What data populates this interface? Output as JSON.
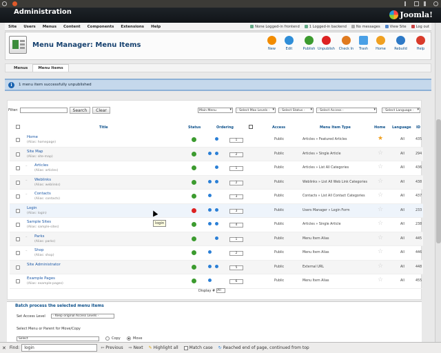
{
  "app": {
    "title": "Administration",
    "logo_text": "Joomla!"
  },
  "menubar": {
    "items": [
      "Site",
      "Users",
      "Menus",
      "Content",
      "Components",
      "Extensions",
      "Help"
    ],
    "status": [
      "None Logged-in frontend",
      "1 Logged-in backend",
      "No messages",
      "View Site",
      "Log out"
    ]
  },
  "page": {
    "title": "Menu Manager: Menu Items"
  },
  "toolbar": {
    "buttons": [
      {
        "label": "New",
        "color": "#f28c00"
      },
      {
        "label": "Edit",
        "color": "#2f8ed8"
      },
      {
        "label": "Publish",
        "color": "#3c9b2f"
      },
      {
        "label": "Unpublish",
        "color": "#d22"
      },
      {
        "label": "Check In",
        "color": "#e07a1f"
      },
      {
        "label": "Trash",
        "color": "#4aa0e6"
      },
      {
        "label": "Home",
        "color": "#f0a020"
      },
      {
        "label": "Rebuild",
        "color": "#2d79c7"
      },
      {
        "label": "Help",
        "color": "#d93b2b"
      }
    ]
  },
  "subnav": {
    "tabs": [
      "Menus",
      "Menu Items"
    ]
  },
  "message": {
    "text": "1 menu item successfully unpublished"
  },
  "filters": {
    "label": "Filter:",
    "search_value": "",
    "search_button": "Search",
    "clear_button": "Clear",
    "selects": [
      "Main Menu",
      "- Select Max Levels -",
      "- Select Status -",
      "- Select Access -",
      "- Select Language -"
    ]
  },
  "table": {
    "headers": {
      "title": "Title",
      "status": "Status",
      "ordering": "Ordering",
      "access": "Access",
      "type": "Menu Item Type",
      "home": "Home",
      "language": "Language",
      "id": "ID"
    },
    "rows": [
      {
        "title": "Home",
        "alias": "(Alias: homepage)",
        "level": 1,
        "status": "published",
        "ord": "1",
        "up": false,
        "down": true,
        "access": "Public",
        "type": "Articles » Featured Articles",
        "home": true,
        "lang": "All",
        "id": "435"
      },
      {
        "title": "Site Map",
        "alias": "(Alias: site-map)",
        "level": 1,
        "status": "published",
        "ord": "2",
        "up": true,
        "down": true,
        "access": "Public",
        "type": "Articles » Single Article",
        "home": false,
        "lang": "All",
        "id": "294"
      },
      {
        "title": "Articles",
        "alias": "(Alias: articles)",
        "level": 2,
        "status": "published",
        "ord": "1",
        "up": false,
        "down": true,
        "access": "Public",
        "type": "Articles » List All Categories",
        "home": false,
        "lang": "All",
        "id": "436"
      },
      {
        "title": "Weblinks",
        "alias": "(Alias: weblinks)",
        "level": 2,
        "status": "published",
        "ord": "2",
        "up": true,
        "down": true,
        "access": "Public",
        "type": "Weblinks » List All Web Link Categories",
        "home": false,
        "lang": "All",
        "id": "438"
      },
      {
        "title": "Contacts",
        "alias": "(Alias: contacts)",
        "level": 2,
        "status": "published",
        "ord": "3",
        "up": true,
        "down": false,
        "access": "Public",
        "type": "Contacts » List All Contact Categories",
        "home": false,
        "lang": "All",
        "id": "437"
      },
      {
        "title": "Login",
        "alias": "(Alias: login)",
        "level": 1,
        "status": "unpublished",
        "ord": "3",
        "up": true,
        "down": true,
        "access": "Public",
        "type": "Users Manager » Login Form",
        "home": false,
        "lang": "All",
        "id": "233"
      },
      {
        "title": "Sample Sites",
        "alias": "(Alias: sample-sites)",
        "level": 1,
        "status": "published",
        "ord": "4",
        "up": true,
        "down": true,
        "access": "Public",
        "type": "Articles » Single Article",
        "home": false,
        "lang": "All",
        "id": "238"
      },
      {
        "title": "Parks",
        "alias": "(Alias: parks)",
        "level": 2,
        "status": "published",
        "ord": "1",
        "up": false,
        "down": true,
        "access": "Public",
        "type": "Menu Item Alias",
        "home": false,
        "lang": "All",
        "id": "445"
      },
      {
        "title": "Shop",
        "alias": "(Alias: shop)",
        "level": 2,
        "status": "published",
        "ord": "2",
        "up": true,
        "down": false,
        "access": "Public",
        "type": "Menu Item Alias",
        "home": false,
        "lang": "All",
        "id": "446"
      },
      {
        "title": "Site Administrator",
        "alias": "",
        "level": 1,
        "status": "published",
        "ord": "5",
        "up": true,
        "down": true,
        "access": "Public",
        "type": "External URL",
        "home": false,
        "lang": "All",
        "id": "448"
      },
      {
        "title": "Example Pages",
        "alias": "(Alias: example-pages)",
        "level": 1,
        "status": "published",
        "ord": "6",
        "up": true,
        "down": false,
        "access": "Public",
        "type": "Menu Item Alias",
        "home": false,
        "lang": "All",
        "id": "455"
      }
    ]
  },
  "display": {
    "label": "Display #",
    "value": "All"
  },
  "batch": {
    "title": "Batch process the selected menu items",
    "access_label": "Set Access Level",
    "access_value": "- Keep original Access Levels -",
    "move_label": "Select Menu or Parent for Move/Copy",
    "select_value": "Select",
    "copy_label": "Copy",
    "move_option": "Move"
  },
  "tooltip": {
    "text": "login"
  },
  "findbar": {
    "label": "Find:",
    "value": "login",
    "previous": "Previous",
    "next": "Next",
    "highlight": "Highlight all",
    "match_case": "Match case",
    "status": "Reached end of page, continued from top"
  },
  "colors": {
    "accent": "#15406e",
    "published": "#3c9b2f",
    "unpublished": "#d22",
    "info_bg": "#c5d8ec"
  }
}
